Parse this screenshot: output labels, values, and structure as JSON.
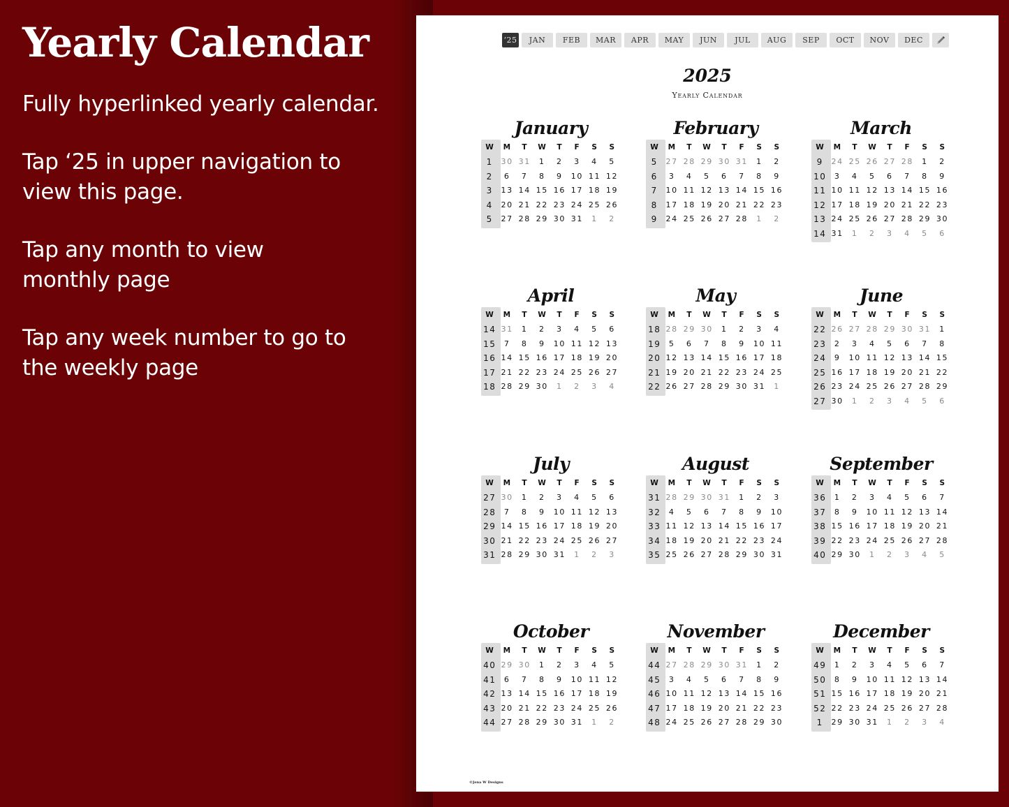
{
  "left": {
    "title": "Yearly Calendar",
    "paragraphs": [
      "Fully hyperlinked yearly calendar.",
      "Tap ‘25 in upper navigation to\nview this page.",
      "Tap any month to view\nmonthly page",
      "Tap any week number to go to\nthe weekly page"
    ]
  },
  "nav": {
    "year": "‘25",
    "months": [
      "JAN",
      "FEB",
      "MAR",
      "APR",
      "MAY",
      "JUN",
      "JUL",
      "AUG",
      "SEP",
      "OCT",
      "NOV",
      "DEC"
    ],
    "pen_icon": "pencil-icon"
  },
  "header": {
    "year": "2025",
    "subtitle": "Yearly Calendar"
  },
  "weekday_headers": [
    "W",
    "M",
    "T",
    "W",
    "T",
    "F",
    "S",
    "S"
  ],
  "months": [
    {
      "name": "January",
      "weeks": [
        {
          "w": "1",
          "days": [
            "30",
            "31",
            "1",
            "2",
            "3",
            "4",
            "5"
          ],
          "dim": [
            0,
            1
          ]
        },
        {
          "w": "2",
          "days": [
            "6",
            "7",
            "8",
            "9",
            "10",
            "11",
            "12"
          ],
          "dim": []
        },
        {
          "w": "3",
          "days": [
            "13",
            "14",
            "15",
            "16",
            "17",
            "18",
            "19"
          ],
          "dim": []
        },
        {
          "w": "4",
          "days": [
            "20",
            "21",
            "22",
            "23",
            "24",
            "25",
            "26"
          ],
          "dim": []
        },
        {
          "w": "5",
          "days": [
            "27",
            "28",
            "29",
            "30",
            "31",
            "1",
            "2"
          ],
          "dim": [
            5,
            6
          ]
        }
      ]
    },
    {
      "name": "February",
      "weeks": [
        {
          "w": "5",
          "days": [
            "27",
            "28",
            "29",
            "30",
            "31",
            "1",
            "2"
          ],
          "dim": [
            0,
            1,
            2,
            3,
            4
          ]
        },
        {
          "w": "6",
          "days": [
            "3",
            "4",
            "5",
            "6",
            "7",
            "8",
            "9"
          ],
          "dim": []
        },
        {
          "w": "7",
          "days": [
            "10",
            "11",
            "12",
            "13",
            "14",
            "15",
            "16"
          ],
          "dim": []
        },
        {
          "w": "8",
          "days": [
            "17",
            "18",
            "19",
            "20",
            "21",
            "22",
            "23"
          ],
          "dim": []
        },
        {
          "w": "9",
          "days": [
            "24",
            "25",
            "26",
            "27",
            "28",
            "1",
            "2"
          ],
          "dim": [
            5,
            6
          ]
        }
      ]
    },
    {
      "name": "March",
      "weeks": [
        {
          "w": "9",
          "days": [
            "24",
            "25",
            "26",
            "27",
            "28",
            "1",
            "2"
          ],
          "dim": [
            0,
            1,
            2,
            3,
            4
          ]
        },
        {
          "w": "10",
          "days": [
            "3",
            "4",
            "5",
            "6",
            "7",
            "8",
            "9"
          ],
          "dim": []
        },
        {
          "w": "11",
          "days": [
            "10",
            "11",
            "12",
            "13",
            "14",
            "15",
            "16"
          ],
          "dim": []
        },
        {
          "w": "12",
          "days": [
            "17",
            "18",
            "19",
            "20",
            "21",
            "22",
            "23"
          ],
          "dim": []
        },
        {
          "w": "13",
          "days": [
            "24",
            "25",
            "26",
            "27",
            "28",
            "29",
            "30"
          ],
          "dim": []
        },
        {
          "w": "14",
          "days": [
            "31",
            "1",
            "2",
            "3",
            "4",
            "5",
            "6"
          ],
          "dim": [
            1,
            2,
            3,
            4,
            5,
            6
          ]
        }
      ]
    },
    {
      "name": "April",
      "weeks": [
        {
          "w": "14",
          "days": [
            "31",
            "1",
            "2",
            "3",
            "4",
            "5",
            "6"
          ],
          "dim": [
            0
          ]
        },
        {
          "w": "15",
          "days": [
            "7",
            "8",
            "9",
            "10",
            "11",
            "12",
            "13"
          ],
          "dim": []
        },
        {
          "w": "16",
          "days": [
            "14",
            "15",
            "16",
            "17",
            "18",
            "19",
            "20"
          ],
          "dim": []
        },
        {
          "w": "17",
          "days": [
            "21",
            "22",
            "23",
            "24",
            "25",
            "26",
            "27"
          ],
          "dim": []
        },
        {
          "w": "18",
          "days": [
            "28",
            "29",
            "30",
            "1",
            "2",
            "3",
            "4"
          ],
          "dim": [
            3,
            4,
            5,
            6
          ]
        }
      ]
    },
    {
      "name": "May",
      "weeks": [
        {
          "w": "18",
          "days": [
            "28",
            "29",
            "30",
            "1",
            "2",
            "3",
            "4"
          ],
          "dim": [
            0,
            1,
            2
          ]
        },
        {
          "w": "19",
          "days": [
            "5",
            "6",
            "7",
            "8",
            "9",
            "10",
            "11"
          ],
          "dim": []
        },
        {
          "w": "20",
          "days": [
            "12",
            "13",
            "14",
            "15",
            "16",
            "17",
            "18"
          ],
          "dim": []
        },
        {
          "w": "21",
          "days": [
            "19",
            "20",
            "21",
            "22",
            "23",
            "24",
            "25"
          ],
          "dim": []
        },
        {
          "w": "22",
          "days": [
            "26",
            "27",
            "28",
            "29",
            "30",
            "31",
            "1"
          ],
          "dim": [
            6
          ]
        }
      ]
    },
    {
      "name": "June",
      "weeks": [
        {
          "w": "22",
          "days": [
            "26",
            "27",
            "28",
            "29",
            "30",
            "31",
            "1"
          ],
          "dim": [
            0,
            1,
            2,
            3,
            4,
            5
          ]
        },
        {
          "w": "23",
          "days": [
            "2",
            "3",
            "4",
            "5",
            "6",
            "7",
            "8"
          ],
          "dim": []
        },
        {
          "w": "24",
          "days": [
            "9",
            "10",
            "11",
            "12",
            "13",
            "14",
            "15"
          ],
          "dim": []
        },
        {
          "w": "25",
          "days": [
            "16",
            "17",
            "18",
            "19",
            "20",
            "21",
            "22"
          ],
          "dim": []
        },
        {
          "w": "26",
          "days": [
            "23",
            "24",
            "25",
            "26",
            "27",
            "28",
            "29"
          ],
          "dim": []
        },
        {
          "w": "27",
          "days": [
            "30",
            "1",
            "2",
            "3",
            "4",
            "5",
            "6"
          ],
          "dim": [
            1,
            2,
            3,
            4,
            5,
            6
          ]
        }
      ]
    },
    {
      "name": "July",
      "weeks": [
        {
          "w": "27",
          "days": [
            "30",
            "1",
            "2",
            "3",
            "4",
            "5",
            "6"
          ],
          "dim": [
            0
          ]
        },
        {
          "w": "28",
          "days": [
            "7",
            "8",
            "9",
            "10",
            "11",
            "12",
            "13"
          ],
          "dim": []
        },
        {
          "w": "29",
          "days": [
            "14",
            "15",
            "16",
            "17",
            "18",
            "19",
            "20"
          ],
          "dim": []
        },
        {
          "w": "30",
          "days": [
            "21",
            "22",
            "23",
            "24",
            "25",
            "26",
            "27"
          ],
          "dim": []
        },
        {
          "w": "31",
          "days": [
            "28",
            "29",
            "30",
            "31",
            "1",
            "2",
            "3"
          ],
          "dim": [
            4,
            5,
            6
          ]
        }
      ]
    },
    {
      "name": "August",
      "weeks": [
        {
          "w": "31",
          "days": [
            "28",
            "29",
            "30",
            "31",
            "1",
            "2",
            "3"
          ],
          "dim": [
            0,
            1,
            2,
            3
          ]
        },
        {
          "w": "32",
          "days": [
            "4",
            "5",
            "6",
            "7",
            "8",
            "9",
            "10"
          ],
          "dim": []
        },
        {
          "w": "33",
          "days": [
            "11",
            "12",
            "13",
            "14",
            "15",
            "16",
            "17"
          ],
          "dim": []
        },
        {
          "w": "34",
          "days": [
            "18",
            "19",
            "20",
            "21",
            "22",
            "23",
            "24"
          ],
          "dim": []
        },
        {
          "w": "35",
          "days": [
            "25",
            "26",
            "27",
            "28",
            "29",
            "30",
            "31"
          ],
          "dim": []
        }
      ]
    },
    {
      "name": "September",
      "weeks": [
        {
          "w": "36",
          "days": [
            "1",
            "2",
            "3",
            "4",
            "5",
            "6",
            "7"
          ],
          "dim": []
        },
        {
          "w": "37",
          "days": [
            "8",
            "9",
            "10",
            "11",
            "12",
            "13",
            "14"
          ],
          "dim": []
        },
        {
          "w": "38",
          "days": [
            "15",
            "16",
            "17",
            "18",
            "19",
            "20",
            "21"
          ],
          "dim": []
        },
        {
          "w": "39",
          "days": [
            "22",
            "23",
            "24",
            "25",
            "26",
            "27",
            "28"
          ],
          "dim": []
        },
        {
          "w": "40",
          "days": [
            "29",
            "30",
            "1",
            "2",
            "3",
            "4",
            "5"
          ],
          "dim": [
            2,
            3,
            4,
            5,
            6
          ]
        }
      ]
    },
    {
      "name": "October",
      "weeks": [
        {
          "w": "40",
          "days": [
            "29",
            "30",
            "1",
            "2",
            "3",
            "4",
            "5"
          ],
          "dim": [
            0,
            1
          ]
        },
        {
          "w": "41",
          "days": [
            "6",
            "7",
            "8",
            "9",
            "10",
            "11",
            "12"
          ],
          "dim": []
        },
        {
          "w": "42",
          "days": [
            "13",
            "14",
            "15",
            "16",
            "17",
            "18",
            "19"
          ],
          "dim": []
        },
        {
          "w": "43",
          "days": [
            "20",
            "21",
            "22",
            "23",
            "24",
            "25",
            "26"
          ],
          "dim": []
        },
        {
          "w": "44",
          "days": [
            "27",
            "28",
            "29",
            "30",
            "31",
            "1",
            "2"
          ],
          "dim": [
            5,
            6
          ]
        }
      ]
    },
    {
      "name": "November",
      "weeks": [
        {
          "w": "44",
          "days": [
            "27",
            "28",
            "29",
            "30",
            "31",
            "1",
            "2"
          ],
          "dim": [
            0,
            1,
            2,
            3,
            4
          ]
        },
        {
          "w": "45",
          "days": [
            "3",
            "4",
            "5",
            "6",
            "7",
            "8",
            "9"
          ],
          "dim": []
        },
        {
          "w": "46",
          "days": [
            "10",
            "11",
            "12",
            "13",
            "14",
            "15",
            "16"
          ],
          "dim": []
        },
        {
          "w": "47",
          "days": [
            "17",
            "18",
            "19",
            "20",
            "21",
            "22",
            "23"
          ],
          "dim": []
        },
        {
          "w": "48",
          "days": [
            "24",
            "25",
            "26",
            "27",
            "28",
            "29",
            "30"
          ],
          "dim": []
        }
      ]
    },
    {
      "name": "December",
      "weeks": [
        {
          "w": "49",
          "days": [
            "1",
            "2",
            "3",
            "4",
            "5",
            "6",
            "7"
          ],
          "dim": []
        },
        {
          "w": "50",
          "days": [
            "8",
            "9",
            "10",
            "11",
            "12",
            "13",
            "14"
          ],
          "dim": []
        },
        {
          "w": "51",
          "days": [
            "15",
            "16",
            "17",
            "18",
            "19",
            "20",
            "21"
          ],
          "dim": []
        },
        {
          "w": "52",
          "days": [
            "22",
            "23",
            "24",
            "25",
            "26",
            "27",
            "28"
          ],
          "dim": []
        },
        {
          "w": "1",
          "days": [
            "29",
            "30",
            "31",
            "1",
            "2",
            "3",
            "4"
          ],
          "dim": [
            3,
            4,
            5,
            6
          ]
        }
      ]
    }
  ],
  "footer": "©Jena W Designs"
}
